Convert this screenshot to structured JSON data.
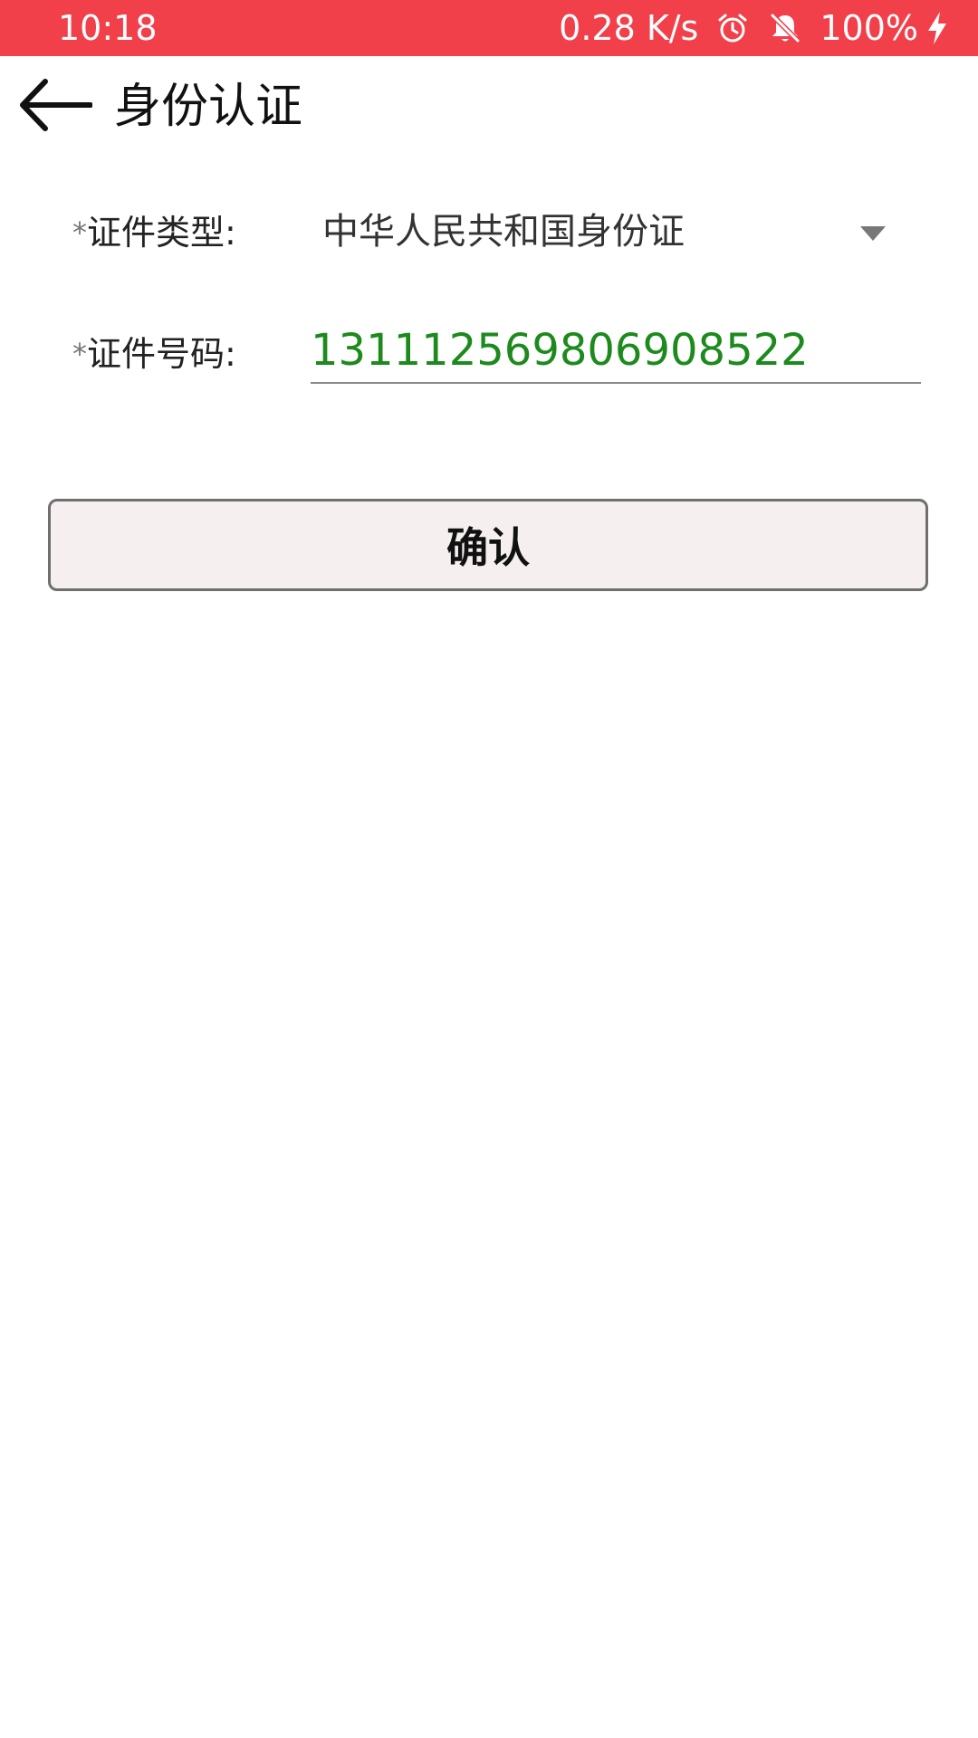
{
  "status_bar": {
    "time": "10:18",
    "network_speed": "0.28 K/s",
    "battery": "100%",
    "icons": [
      "alarm-icon",
      "notifications-off-icon",
      "charging-bolt-icon"
    ],
    "background": "#f2404a"
  },
  "app_bar": {
    "back_icon": "arrow-left-icon",
    "title": "身份认证"
  },
  "form": {
    "id_type": {
      "required_mark": "*",
      "label": "证件类型:",
      "value": "中华人民共和国身份证"
    },
    "id_number": {
      "required_mark": "*",
      "label": "证件号码:",
      "value": "131112569806908522",
      "value_color": "#1d8a1d"
    }
  },
  "confirm_button": {
    "label": "确认"
  }
}
